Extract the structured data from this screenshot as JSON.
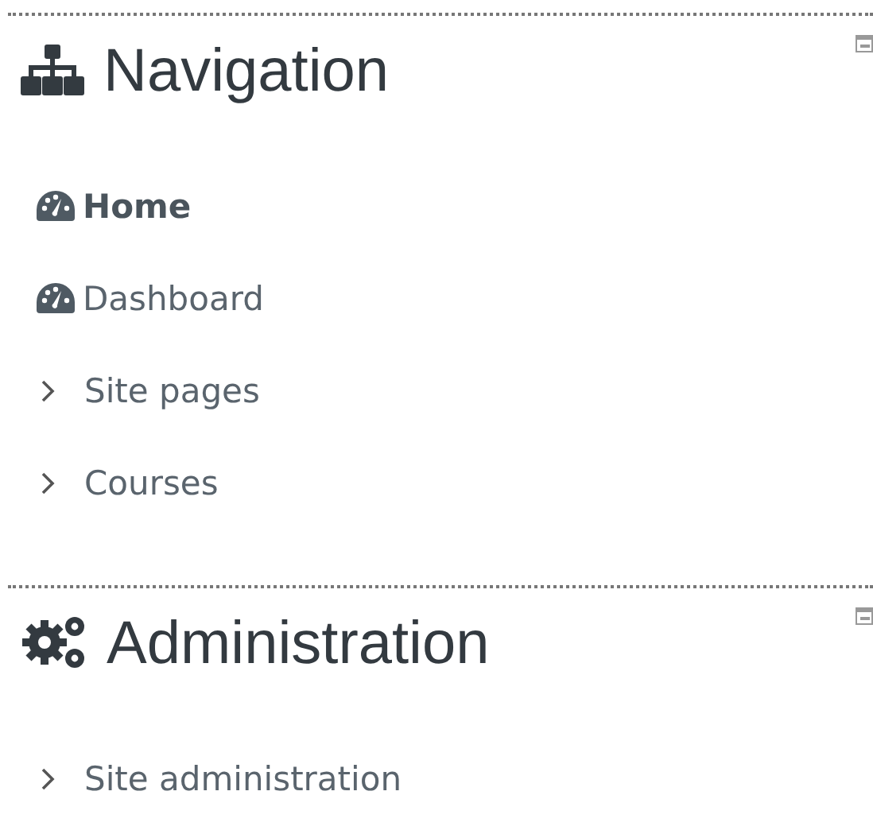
{
  "blocks": [
    {
      "kind": "sitemap",
      "title": "Navigation",
      "collapsed": false,
      "items": [
        {
          "kind": "link",
          "label": "Home",
          "current": true
        },
        {
          "kind": "link",
          "label": "Dashboard",
          "current": false
        },
        {
          "kind": "branch",
          "label": "Site pages",
          "current": false
        },
        {
          "kind": "branch",
          "label": "Courses",
          "current": false
        }
      ]
    },
    {
      "kind": "gears",
      "title": "Administration",
      "collapsed": false,
      "items": [
        {
          "kind": "branch",
          "label": "Site administration",
          "current": false
        }
      ]
    }
  ]
}
